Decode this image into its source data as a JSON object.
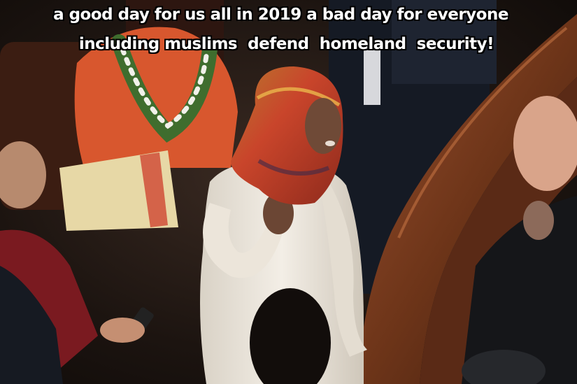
{
  "meme": {
    "line1": "a good day for us all in 2019 a bad day for everyone",
    "line2": "including muslims  defend  homeland  security!"
  },
  "colors": {
    "background": "#1a1310",
    "wood_bench": "#7a3e22",
    "orange_jacket": "#d8572e",
    "white_sweater": "#efe9df",
    "hijab": "#c9452b",
    "caption_text": "#ffffff",
    "caption_outline": "#000000"
  }
}
